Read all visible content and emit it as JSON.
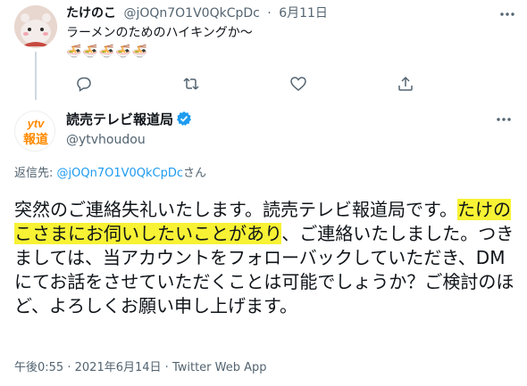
{
  "parent_tweet": {
    "display_name": "たけのこ",
    "handle": "@jOQn7O1V0QkCpDc",
    "separator": "·",
    "date": "6月11日",
    "text": "ラーメンのためのハイキングか〜",
    "emoji": "🍜🍜🍜🍜🍜"
  },
  "main_tweet": {
    "display_name": "読売テレビ報道局",
    "handle": "@ytvhoudou",
    "logo_text_top": "ytv",
    "logo_text_bottom": "報道",
    "reply_prefix": "返信先: ",
    "reply_target": "@jOQn7O1V0QkCpDc",
    "reply_suffix": "さん",
    "text_part1": "突然のご連絡失礼いたします。読売テレビ報道局です。",
    "text_highlight": "たけのこさまにお伺いしたいことがあり",
    "text_part2": "、ご連絡いたしました。つきましては、当アカウントをフォローバックしていただき、DMにてお話をさせていただくことは可能でしょうか？ご検討のほど、よろしくお願い申し上げます。",
    "time": "午後0:55",
    "date": "2021年6月14日",
    "source": "Twitter Web App",
    "separator": "·"
  },
  "colors": {
    "text": "#0f1419",
    "muted": "#536471",
    "link": "#1d9bf0",
    "highlight": "#f7f234",
    "ytv_orange": "#ff8a00"
  }
}
